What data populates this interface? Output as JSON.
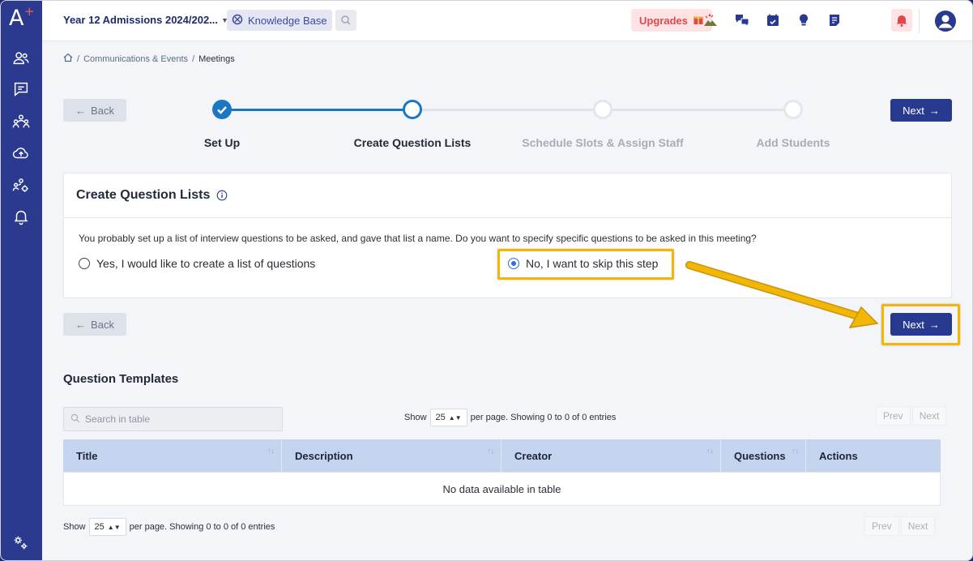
{
  "app": {
    "logo": "A",
    "logo_plus": "+"
  },
  "topbar": {
    "context_title": "Year 12 Admissions 2024/202...",
    "knowledge_base": "Knowledge Base",
    "upgrades": "Upgrades"
  },
  "breadcrumb": {
    "items": [
      "Communications & Events",
      "Meetings"
    ],
    "separator": "/"
  },
  "stepper": {
    "back_label": "Back",
    "next_label": "Next",
    "steps": [
      {
        "label": "Set Up",
        "state": "done"
      },
      {
        "label": "Create Question Lists",
        "state": "current"
      },
      {
        "label": "Schedule Slots & Assign Staff",
        "state": "pending"
      },
      {
        "label": "Add Students",
        "state": "pending"
      }
    ]
  },
  "card": {
    "title": "Create Question Lists",
    "question": "You probably set up a list of interview questions to be asked, and gave that list a name. Do you want to specify specific questions to be asked in this meeting?",
    "options": [
      {
        "label": "Yes, I would like to create a list of questions",
        "selected": false
      },
      {
        "label": "No, I want to skip this step",
        "selected": true
      }
    ]
  },
  "bottom_nav": {
    "back_label": "Back",
    "next_label": "Next"
  },
  "templates": {
    "title": "Question Templates",
    "search_placeholder": "Search in table",
    "show_label": "Show",
    "page_size": "25",
    "per_page_text": "per page. Showing 0 to 0 of 0 entries",
    "prev_label": "Prev",
    "next_label": "Next",
    "columns": [
      "Title",
      "Description",
      "Creator",
      "Questions",
      "Actions"
    ],
    "empty_text": "No data available in table"
  },
  "colors": {
    "sidebar": "#2b3a8f",
    "primary": "#283a8f",
    "step_done": "#1a78c2",
    "highlight": "#f2b705",
    "upgrades_text": "#e0484c"
  },
  "icons": {
    "sidebar": [
      "users-icon",
      "message-icon",
      "group-icon",
      "cloud-upload-icon",
      "users-cog-icon",
      "bell-icon",
      "settings-cogs-icon"
    ],
    "topbar": [
      "volcano-icon",
      "chat-bubbles-icon",
      "calendar-icon",
      "lightbulb-icon",
      "notes-icon",
      "alert-bell-icon",
      "user-circle-icon"
    ]
  }
}
